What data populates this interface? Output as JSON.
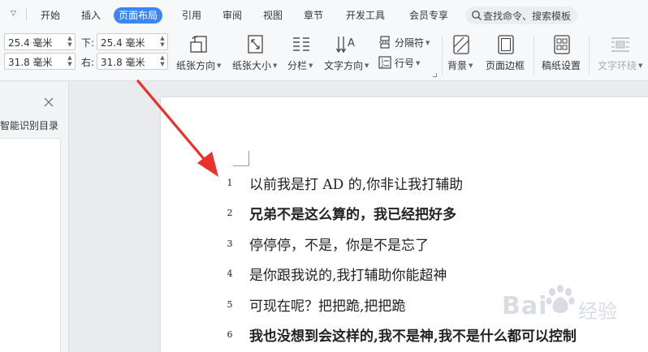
{
  "tabs": [
    {
      "label": "开始"
    },
    {
      "label": "插入"
    },
    {
      "label": "页面布局",
      "active": true
    },
    {
      "label": "引用"
    },
    {
      "label": "审阅"
    },
    {
      "label": "视图"
    },
    {
      "label": "章节"
    },
    {
      "label": "开发工具"
    },
    {
      "label": "会员专享"
    }
  ],
  "search": {
    "placeholder": "查找命令、搜索模板"
  },
  "margins": {
    "top_value": "25.4 毫米",
    "bottom_label": "下:",
    "bottom_value": "25.4 毫米",
    "left_value": "31.8 毫米",
    "right_label": "右:",
    "right_value": "31.8 毫米"
  },
  "ribbon": {
    "orientation": "纸张方向",
    "size": "纸张大小",
    "columns": "分栏",
    "text_direction": "文字方向",
    "breaks": "分隔符",
    "line_numbers": "行号",
    "background": "背景",
    "page_border": "页面边框",
    "grid_paper": "稿纸设置",
    "text_wrap": "文字环绕"
  },
  "left_pane": {
    "title": "智能识别目录"
  },
  "document": {
    "lines": [
      {
        "num": "1",
        "text": "以前我是打 AD 的,你非让我打辅助",
        "bold": false
      },
      {
        "num": "2",
        "text": "兄弟不是这么算的，我已经把好多",
        "bold": true
      },
      {
        "num": "3",
        "text": "停停停，不是，你是不是忘了",
        "bold": false
      },
      {
        "num": "4",
        "text": "是你跟我说的,我打辅助你能超神",
        "bold": false
      },
      {
        "num": "5",
        "text": "可现在呢？把把跪,把把跪",
        "bold": false
      },
      {
        "num": "6",
        "text": "我也没想到会这样的,我不是神,我不是什么都可以控制",
        "bold": true
      }
    ]
  },
  "watermark": {
    "text": "Bai",
    "sub": "经验"
  },
  "colors": {
    "accent": "#3b86f5",
    "arrow": "#e8322b",
    "background": "#e9ebee"
  }
}
